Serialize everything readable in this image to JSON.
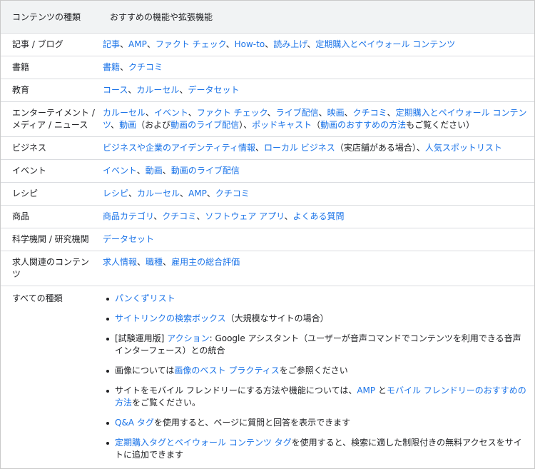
{
  "header": {
    "col1": "コンテンツの種類",
    "col2": "おすすめの機能や拡張機能"
  },
  "rows": [
    {
      "type": "記事 / ブログ",
      "parts": [
        {
          "t": "記事",
          "link": true
        },
        {
          "t": "、",
          "link": false
        },
        {
          "t": "AMP",
          "link": true
        },
        {
          "t": "、",
          "link": false
        },
        {
          "t": "ファクト チェック",
          "link": true
        },
        {
          "t": "、",
          "link": false
        },
        {
          "t": "How-to",
          "link": true
        },
        {
          "t": "、",
          "link": false
        },
        {
          "t": "読み上げ",
          "link": true
        },
        {
          "t": "、",
          "link": false
        },
        {
          "t": "定期購入とペイウォール コンテンツ",
          "link": true
        }
      ]
    },
    {
      "type": "書籍",
      "parts": [
        {
          "t": "書籍",
          "link": true
        },
        {
          "t": "、",
          "link": false
        },
        {
          "t": "クチコミ",
          "link": true
        }
      ]
    },
    {
      "type": "教育",
      "parts": [
        {
          "t": "コース",
          "link": true
        },
        {
          "t": "、",
          "link": false
        },
        {
          "t": "カルーセル",
          "link": true
        },
        {
          "t": "、",
          "link": false
        },
        {
          "t": "データセット",
          "link": true
        }
      ]
    },
    {
      "type": "エンターテイメント / メディア / ニュース",
      "parts": [
        {
          "t": "カルーセル",
          "link": true
        },
        {
          "t": "、",
          "link": false
        },
        {
          "t": "イベント",
          "link": true
        },
        {
          "t": "、",
          "link": false
        },
        {
          "t": "ファクト チェック",
          "link": true
        },
        {
          "t": "、",
          "link": false
        },
        {
          "t": "ライブ配信",
          "link": true
        },
        {
          "t": "、",
          "link": false
        },
        {
          "t": "映画",
          "link": true
        },
        {
          "t": "、",
          "link": false
        },
        {
          "t": "クチコミ",
          "link": true
        },
        {
          "t": "、",
          "link": false
        },
        {
          "t": "定期購入とペイウォール コンテンツ",
          "link": true
        },
        {
          "t": "、",
          "link": false
        },
        {
          "t": "動画",
          "link": true
        },
        {
          "t": "（および",
          "link": false
        },
        {
          "t": "動画のライブ配信",
          "link": true
        },
        {
          "t": "）、",
          "link": false
        },
        {
          "t": "ポッドキャスト",
          "link": true
        },
        {
          "t": "（",
          "link": false
        },
        {
          "t": "動画のおすすめの方法",
          "link": true
        },
        {
          "t": "もご覧ください）",
          "link": false
        }
      ]
    },
    {
      "type": "ビジネス",
      "parts": [
        {
          "t": "ビジネスや企業のアイデンティティ情報",
          "link": true
        },
        {
          "t": "、",
          "link": false
        },
        {
          "t": "ローカル ビジネス",
          "link": true
        },
        {
          "t": "（実店舗がある場合）、",
          "link": false
        },
        {
          "t": "人気スポットリスト",
          "link": true
        }
      ]
    },
    {
      "type": "イベント",
      "parts": [
        {
          "t": "イベント",
          "link": true
        },
        {
          "t": "、",
          "link": false
        },
        {
          "t": "動画",
          "link": true
        },
        {
          "t": "、",
          "link": false
        },
        {
          "t": "動画のライブ配信",
          "link": true
        }
      ]
    },
    {
      "type": "レシピ",
      "parts": [
        {
          "t": "レシピ",
          "link": true
        },
        {
          "t": "、",
          "link": false
        },
        {
          "t": "カルーセル",
          "link": true
        },
        {
          "t": "、",
          "link": false
        },
        {
          "t": "AMP",
          "link": true
        },
        {
          "t": "、",
          "link": false
        },
        {
          "t": "クチコミ",
          "link": true
        }
      ]
    },
    {
      "type": "商品",
      "parts": [
        {
          "t": "商品カテゴリ",
          "link": true
        },
        {
          "t": "、",
          "link": false
        },
        {
          "t": "クチコミ",
          "link": true
        },
        {
          "t": "、",
          "link": false
        },
        {
          "t": "ソフトウェア アプリ",
          "link": true
        },
        {
          "t": "、",
          "link": false
        },
        {
          "t": "よくある質問",
          "link": true
        }
      ]
    },
    {
      "type": "科学機関 / 研究機関",
      "parts": [
        {
          "t": "データセット",
          "link": true
        }
      ]
    },
    {
      "type": "求人関連のコンテンツ",
      "parts": [
        {
          "t": "求人情報",
          "link": true
        },
        {
          "t": "、",
          "link": false
        },
        {
          "t": "職種",
          "link": true
        },
        {
          "t": "、",
          "link": false
        },
        {
          "t": "雇用主の総合評価",
          "link": true
        }
      ]
    }
  ],
  "all_types": {
    "type": "すべての種類",
    "bullets": [
      [
        {
          "t": "パンくずリスト",
          "link": true
        }
      ],
      [
        {
          "t": "サイトリンクの検索ボックス",
          "link": true
        },
        {
          "t": "（大規模なサイトの場合）",
          "link": false
        }
      ],
      [
        {
          "t": "[試験運用版] ",
          "link": false
        },
        {
          "t": "アクション",
          "link": true
        },
        {
          "t": ": Google アシスタント（ユーザーが音声コマンドでコンテンツを利用できる音声インターフェース）との統合",
          "link": false
        }
      ],
      [
        {
          "t": "画像については",
          "link": false
        },
        {
          "t": "画像のベスト プラクティス",
          "link": true
        },
        {
          "t": "をご参照ください",
          "link": false
        }
      ],
      [
        {
          "t": "サイトをモバイル フレンドリーにする方法や機能については、",
          "link": false
        },
        {
          "t": "AMP",
          "link": true
        },
        {
          "t": " と",
          "link": false
        },
        {
          "t": "モバイル フレンドリーのおすすめの方法",
          "link": true
        },
        {
          "t": "をご覧ください。",
          "link": false
        }
      ],
      [
        {
          "t": "Q&A タグ",
          "link": true
        },
        {
          "t": "を使用すると、ページに質問と回答を表示できます",
          "link": false
        }
      ],
      [
        {
          "t": "定期購入タグとペイウォール コンテンツ タグ",
          "link": true
        },
        {
          "t": "を使用すると、検索に適した制限付きの無料アクセスをサイトに追加できます",
          "link": false
        }
      ]
    ]
  },
  "colors": {
    "link": "#1a73e8",
    "text": "#202124",
    "header_bg": "#f1f3f4",
    "border": "#dadce0"
  }
}
